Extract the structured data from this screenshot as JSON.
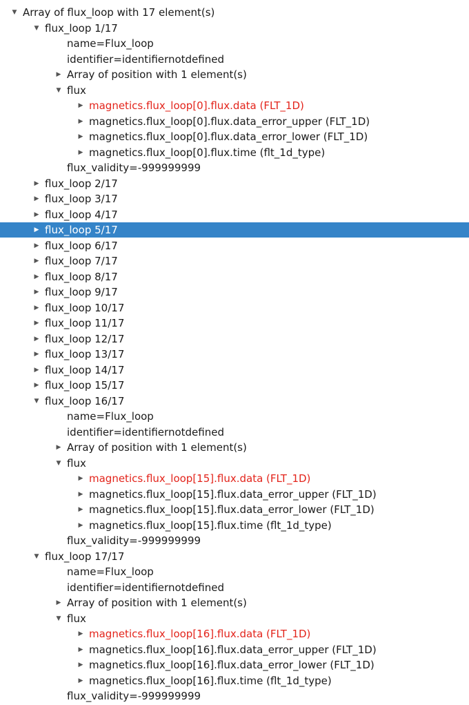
{
  "tree": {
    "rows": [
      {
        "text": "Array of flux_loop with 17 element(s)",
        "level": 0,
        "expander": "expanded"
      },
      {
        "text": "flux_loop 1/17",
        "level": 1,
        "expander": "expanded"
      },
      {
        "text": "name=Flux_loop",
        "level": 2,
        "expander": "none"
      },
      {
        "text": "identifier=identifiernotdefined",
        "level": 2,
        "expander": "none"
      },
      {
        "text": "Array of position with 1 element(s)",
        "level": 2,
        "expander": "collapsed"
      },
      {
        "text": "flux",
        "level": 2,
        "expander": "expanded"
      },
      {
        "text": "magnetics.flux_loop[0].flux.data (FLT_1D)",
        "level": 3,
        "expander": "collapsed",
        "highlight": true
      },
      {
        "text": "magnetics.flux_loop[0].flux.data_error_upper (FLT_1D)",
        "level": 3,
        "expander": "collapsed"
      },
      {
        "text": "magnetics.flux_loop[0].flux.data_error_lower (FLT_1D)",
        "level": 3,
        "expander": "collapsed"
      },
      {
        "text": "magnetics.flux_loop[0].flux.time (flt_1d_type)",
        "level": 3,
        "expander": "collapsed"
      },
      {
        "text": "flux_validity=-999999999",
        "level": 2,
        "expander": "none"
      },
      {
        "text": "flux_loop 2/17",
        "level": 1,
        "expander": "collapsed"
      },
      {
        "text": "flux_loop 3/17",
        "level": 1,
        "expander": "collapsed"
      },
      {
        "text": "flux_loop 4/17",
        "level": 1,
        "expander": "collapsed"
      },
      {
        "text": "flux_loop 5/17",
        "level": 1,
        "expander": "collapsed",
        "selected": true
      },
      {
        "text": "flux_loop 6/17",
        "level": 1,
        "expander": "collapsed"
      },
      {
        "text": "flux_loop 7/17",
        "level": 1,
        "expander": "collapsed"
      },
      {
        "text": "flux_loop 8/17",
        "level": 1,
        "expander": "collapsed"
      },
      {
        "text": "flux_loop 9/17",
        "level": 1,
        "expander": "collapsed"
      },
      {
        "text": "flux_loop 10/17",
        "level": 1,
        "expander": "collapsed"
      },
      {
        "text": "flux_loop 11/17",
        "level": 1,
        "expander": "collapsed"
      },
      {
        "text": "flux_loop 12/17",
        "level": 1,
        "expander": "collapsed"
      },
      {
        "text": "flux_loop 13/17",
        "level": 1,
        "expander": "collapsed"
      },
      {
        "text": "flux_loop 14/17",
        "level": 1,
        "expander": "collapsed"
      },
      {
        "text": "flux_loop 15/17",
        "level": 1,
        "expander": "collapsed"
      },
      {
        "text": "flux_loop 16/17",
        "level": 1,
        "expander": "expanded"
      },
      {
        "text": "name=Flux_loop",
        "level": 2,
        "expander": "none"
      },
      {
        "text": "identifier=identifiernotdefined",
        "level": 2,
        "expander": "none"
      },
      {
        "text": "Array of position with 1 element(s)",
        "level": 2,
        "expander": "collapsed"
      },
      {
        "text": "flux",
        "level": 2,
        "expander": "expanded"
      },
      {
        "text": "magnetics.flux_loop[15].flux.data (FLT_1D)",
        "level": 3,
        "expander": "collapsed",
        "highlight": true
      },
      {
        "text": "magnetics.flux_loop[15].flux.data_error_upper (FLT_1D)",
        "level": 3,
        "expander": "collapsed"
      },
      {
        "text": "magnetics.flux_loop[15].flux.data_error_lower (FLT_1D)",
        "level": 3,
        "expander": "collapsed"
      },
      {
        "text": "magnetics.flux_loop[15].flux.time (flt_1d_type)",
        "level": 3,
        "expander": "collapsed"
      },
      {
        "text": "flux_validity=-999999999",
        "level": 2,
        "expander": "none"
      },
      {
        "text": "flux_loop 17/17",
        "level": 1,
        "expander": "expanded"
      },
      {
        "text": "name=Flux_loop",
        "level": 2,
        "expander": "none"
      },
      {
        "text": "identifier=identifiernotdefined",
        "level": 2,
        "expander": "none"
      },
      {
        "text": "Array of position with 1 element(s)",
        "level": 2,
        "expander": "collapsed"
      },
      {
        "text": "flux",
        "level": 2,
        "expander": "expanded"
      },
      {
        "text": "magnetics.flux_loop[16].flux.data (FLT_1D)",
        "level": 3,
        "expander": "collapsed",
        "highlight": true
      },
      {
        "text": "magnetics.flux_loop[16].flux.data_error_upper (FLT_1D)",
        "level": 3,
        "expander": "collapsed"
      },
      {
        "text": "magnetics.flux_loop[16].flux.data_error_lower (FLT_1D)",
        "level": 3,
        "expander": "collapsed"
      },
      {
        "text": "magnetics.flux_loop[16].flux.time (flt_1d_type)",
        "level": 3,
        "expander": "collapsed"
      },
      {
        "text": "flux_validity=-999999999",
        "level": 2,
        "expander": "none"
      }
    ]
  },
  "colors": {
    "selection": "#3584c8",
    "highlight_text": "#e3241b",
    "text": "#1a1a1a",
    "background": "#ffffff"
  }
}
